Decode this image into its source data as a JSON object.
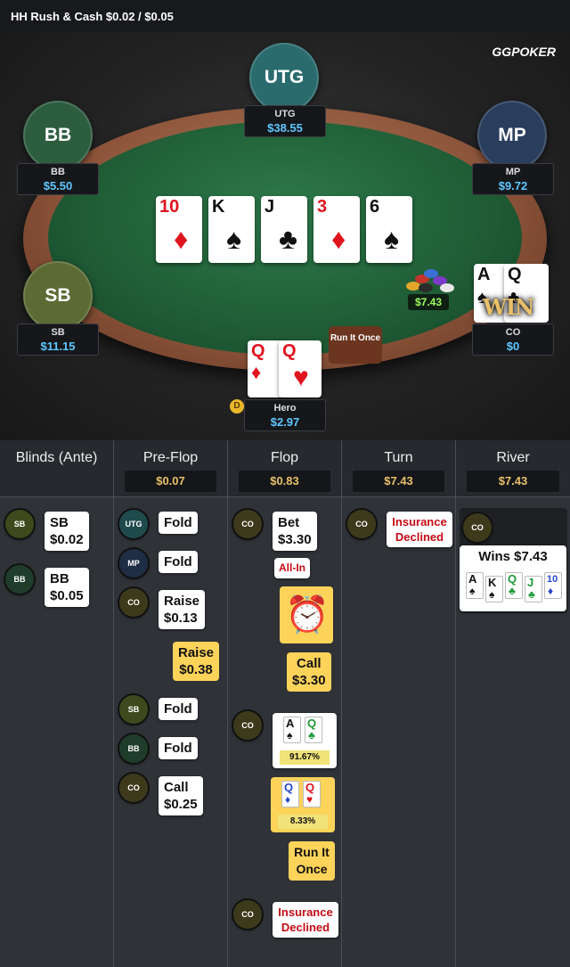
{
  "header": {
    "title": "HH  Rush & Cash $0.02 / $0.05"
  },
  "logo": "GGPOKER",
  "seats": {
    "utg": {
      "avatar": "UTG",
      "name": "UTG",
      "stack": "$38.55",
      "color": "#2a6b6e"
    },
    "bb": {
      "avatar": "BB",
      "name": "BB",
      "stack": "$5.50",
      "color": "#2d5d3f"
    },
    "mp": {
      "avatar": "MP",
      "name": "MP",
      "stack": "$9.72",
      "color": "#293d5c"
    },
    "sb": {
      "avatar": "SB",
      "name": "SB",
      "stack": "$11.15",
      "color": "#5b6b33"
    },
    "co": {
      "name": "CO",
      "stack": "$0"
    },
    "hero": {
      "name": "Hero",
      "stack": "$2.97"
    }
  },
  "board": [
    {
      "rank": "10",
      "suit": "♦",
      "color": "red"
    },
    {
      "rank": "K",
      "suit": "♠",
      "color": "blk"
    },
    {
      "rank": "J",
      "suit": "♣",
      "color": "blk"
    },
    {
      "rank": "3",
      "suit": "♦",
      "color": "red"
    },
    {
      "rank": "6",
      "suit": "♠",
      "color": "blk"
    }
  ],
  "co_cards": [
    {
      "rank": "A",
      "suit": "♠"
    },
    {
      "rank": "Q",
      "suit": "♣"
    }
  ],
  "hero_cards": [
    {
      "rank": "Q",
      "suit": "♦"
    },
    {
      "rank": "Q",
      "suit": "♥"
    }
  ],
  "pot_amount": "$7.43",
  "win_badge": "WIN",
  "run_it_button": "Run It Once",
  "dealer_button": "D",
  "table_letters": [
    "S",
    "A",
    "U",
    "S",
    "A",
    "U"
  ],
  "columns": [
    {
      "title": "Blinds (Ante)",
      "pot": ""
    },
    {
      "title": "Pre-Flop",
      "pot": "$0.07"
    },
    {
      "title": "Flop",
      "pot": "$0.83"
    },
    {
      "title": "Turn",
      "pot": "$7.43"
    },
    {
      "title": "River",
      "pot": "$7.43"
    }
  ],
  "blinds": [
    {
      "pos": "SB",
      "action": "SB",
      "amount": "$0.02"
    },
    {
      "pos": "BB",
      "action": "BB",
      "amount": "$0.05"
    }
  ],
  "preflop": [
    {
      "pos": "UTG",
      "action": "Fold"
    },
    {
      "pos": "MP",
      "action": "Fold"
    },
    {
      "pos": "CO",
      "action": "Raise",
      "amount": "$0.13"
    },
    {
      "hero_action": "Raise",
      "hero_amount": "$0.38"
    },
    {
      "pos": "SB",
      "action": "Fold"
    },
    {
      "pos": "BB",
      "action": "Fold"
    },
    {
      "pos": "CO",
      "action": "Call",
      "amount": "$0.25"
    }
  ],
  "flop": {
    "co_action": "Bet",
    "co_amount": "$3.30",
    "allin": "All-In",
    "hero_call": "Call",
    "hero_call_amount": "$3.30",
    "co_equity": "91.67%",
    "hero_equity": "8.33%",
    "run_it": "Run It Once",
    "insurance": "Insurance Declined",
    "co_pos": "CO"
  },
  "turn": {
    "pos": "CO",
    "text": "Insurance Declined"
  },
  "river": {
    "pos": "CO",
    "wins": "Wins $7.43",
    "hand": [
      {
        "rank": "A",
        "suit": "♠",
        "color": "blk"
      },
      {
        "rank": "K",
        "suit": "♠",
        "color": "blk"
      },
      {
        "rank": "Q",
        "suit": "♣",
        "color": "grn"
      },
      {
        "rank": "J",
        "suit": "♣",
        "color": "grn"
      },
      {
        "rank": "10",
        "suit": "♦",
        "color": "blu"
      }
    ]
  }
}
